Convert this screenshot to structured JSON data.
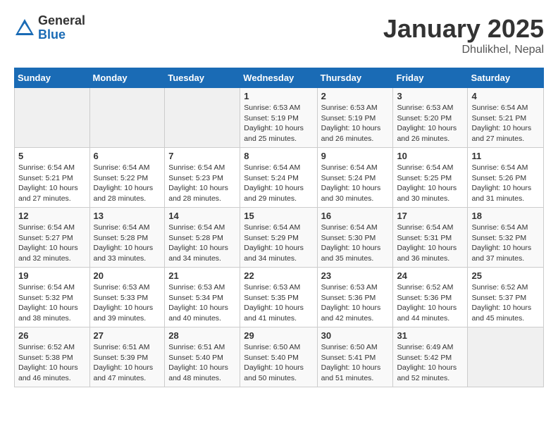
{
  "header": {
    "logo_general": "General",
    "logo_blue": "Blue",
    "month_title": "January 2025",
    "location": "Dhulikhel, Nepal"
  },
  "days_of_week": [
    "Sunday",
    "Monday",
    "Tuesday",
    "Wednesday",
    "Thursday",
    "Friday",
    "Saturday"
  ],
  "weeks": [
    [
      {
        "day": "",
        "info": ""
      },
      {
        "day": "",
        "info": ""
      },
      {
        "day": "",
        "info": ""
      },
      {
        "day": "1",
        "info": "Sunrise: 6:53 AM\nSunset: 5:19 PM\nDaylight: 10 hours\nand 25 minutes."
      },
      {
        "day": "2",
        "info": "Sunrise: 6:53 AM\nSunset: 5:19 PM\nDaylight: 10 hours\nand 26 minutes."
      },
      {
        "day": "3",
        "info": "Sunrise: 6:53 AM\nSunset: 5:20 PM\nDaylight: 10 hours\nand 26 minutes."
      },
      {
        "day": "4",
        "info": "Sunrise: 6:54 AM\nSunset: 5:21 PM\nDaylight: 10 hours\nand 27 minutes."
      }
    ],
    [
      {
        "day": "5",
        "info": "Sunrise: 6:54 AM\nSunset: 5:21 PM\nDaylight: 10 hours\nand 27 minutes."
      },
      {
        "day": "6",
        "info": "Sunrise: 6:54 AM\nSunset: 5:22 PM\nDaylight: 10 hours\nand 28 minutes."
      },
      {
        "day": "7",
        "info": "Sunrise: 6:54 AM\nSunset: 5:23 PM\nDaylight: 10 hours\nand 28 minutes."
      },
      {
        "day": "8",
        "info": "Sunrise: 6:54 AM\nSunset: 5:24 PM\nDaylight: 10 hours\nand 29 minutes."
      },
      {
        "day": "9",
        "info": "Sunrise: 6:54 AM\nSunset: 5:24 PM\nDaylight: 10 hours\nand 30 minutes."
      },
      {
        "day": "10",
        "info": "Sunrise: 6:54 AM\nSunset: 5:25 PM\nDaylight: 10 hours\nand 30 minutes."
      },
      {
        "day": "11",
        "info": "Sunrise: 6:54 AM\nSunset: 5:26 PM\nDaylight: 10 hours\nand 31 minutes."
      }
    ],
    [
      {
        "day": "12",
        "info": "Sunrise: 6:54 AM\nSunset: 5:27 PM\nDaylight: 10 hours\nand 32 minutes."
      },
      {
        "day": "13",
        "info": "Sunrise: 6:54 AM\nSunset: 5:28 PM\nDaylight: 10 hours\nand 33 minutes."
      },
      {
        "day": "14",
        "info": "Sunrise: 6:54 AM\nSunset: 5:28 PM\nDaylight: 10 hours\nand 34 minutes."
      },
      {
        "day": "15",
        "info": "Sunrise: 6:54 AM\nSunset: 5:29 PM\nDaylight: 10 hours\nand 34 minutes."
      },
      {
        "day": "16",
        "info": "Sunrise: 6:54 AM\nSunset: 5:30 PM\nDaylight: 10 hours\nand 35 minutes."
      },
      {
        "day": "17",
        "info": "Sunrise: 6:54 AM\nSunset: 5:31 PM\nDaylight: 10 hours\nand 36 minutes."
      },
      {
        "day": "18",
        "info": "Sunrise: 6:54 AM\nSunset: 5:32 PM\nDaylight: 10 hours\nand 37 minutes."
      }
    ],
    [
      {
        "day": "19",
        "info": "Sunrise: 6:54 AM\nSunset: 5:32 PM\nDaylight: 10 hours\nand 38 minutes."
      },
      {
        "day": "20",
        "info": "Sunrise: 6:53 AM\nSunset: 5:33 PM\nDaylight: 10 hours\nand 39 minutes."
      },
      {
        "day": "21",
        "info": "Sunrise: 6:53 AM\nSunset: 5:34 PM\nDaylight: 10 hours\nand 40 minutes."
      },
      {
        "day": "22",
        "info": "Sunrise: 6:53 AM\nSunset: 5:35 PM\nDaylight: 10 hours\nand 41 minutes."
      },
      {
        "day": "23",
        "info": "Sunrise: 6:53 AM\nSunset: 5:36 PM\nDaylight: 10 hours\nand 42 minutes."
      },
      {
        "day": "24",
        "info": "Sunrise: 6:52 AM\nSunset: 5:36 PM\nDaylight: 10 hours\nand 44 minutes."
      },
      {
        "day": "25",
        "info": "Sunrise: 6:52 AM\nSunset: 5:37 PM\nDaylight: 10 hours\nand 45 minutes."
      }
    ],
    [
      {
        "day": "26",
        "info": "Sunrise: 6:52 AM\nSunset: 5:38 PM\nDaylight: 10 hours\nand 46 minutes."
      },
      {
        "day": "27",
        "info": "Sunrise: 6:51 AM\nSunset: 5:39 PM\nDaylight: 10 hours\nand 47 minutes."
      },
      {
        "day": "28",
        "info": "Sunrise: 6:51 AM\nSunset: 5:40 PM\nDaylight: 10 hours\nand 48 minutes."
      },
      {
        "day": "29",
        "info": "Sunrise: 6:50 AM\nSunset: 5:40 PM\nDaylight: 10 hours\nand 50 minutes."
      },
      {
        "day": "30",
        "info": "Sunrise: 6:50 AM\nSunset: 5:41 PM\nDaylight: 10 hours\nand 51 minutes."
      },
      {
        "day": "31",
        "info": "Sunrise: 6:49 AM\nSunset: 5:42 PM\nDaylight: 10 hours\nand 52 minutes."
      },
      {
        "day": "",
        "info": ""
      }
    ]
  ]
}
